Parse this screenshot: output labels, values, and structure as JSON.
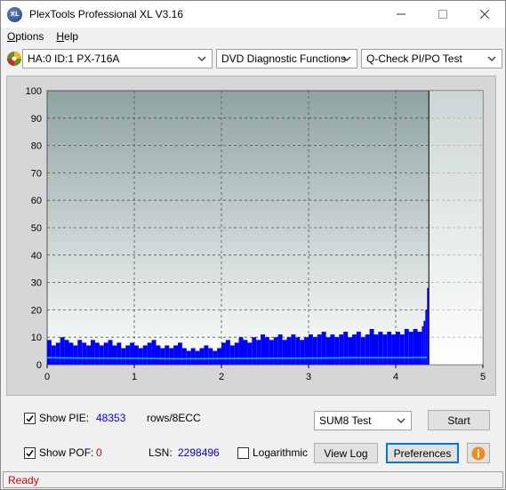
{
  "window": {
    "title": "PlexTools Professional XL V3.16",
    "icon_text": "XL"
  },
  "menu": [
    {
      "label": "Options",
      "mnemonic": "O"
    },
    {
      "label": "Help",
      "mnemonic": "H"
    }
  ],
  "toolbar": {
    "drive": "HA:0 ID:1  PX-716A",
    "function": "DVD Diagnostic Functions",
    "test": "Q-Check PI/PO Test"
  },
  "chart_data": {
    "type": "bar",
    "x_ticks": [
      "0",
      "1",
      "2",
      "3",
      "4",
      "5"
    ],
    "y_ticks": [
      "0",
      "10",
      "20",
      "30",
      "40",
      "50",
      "60",
      "70",
      "80",
      "90",
      "100"
    ],
    "xlim": [
      0,
      5
    ],
    "ylim": [
      0,
      100
    ],
    "grid": true,
    "end_marker_x": 4.38,
    "series": [
      {
        "style": "bars",
        "color": "#0000ff",
        "x": [
          0.0,
          0.05,
          0.1,
          0.15,
          0.2,
          0.25,
          0.3,
          0.35,
          0.4,
          0.45,
          0.5,
          0.55,
          0.6,
          0.65,
          0.7,
          0.75,
          0.8,
          0.85,
          0.9,
          0.95,
          1.0,
          1.05,
          1.1,
          1.15,
          1.2,
          1.25,
          1.3,
          1.35,
          1.4,
          1.45,
          1.5,
          1.55,
          1.6,
          1.65,
          1.7,
          1.75,
          1.8,
          1.85,
          1.9,
          1.95,
          2.0,
          2.05,
          2.1,
          2.15,
          2.2,
          2.25,
          2.3,
          2.35,
          2.4,
          2.45,
          2.5,
          2.55,
          2.6,
          2.65,
          2.7,
          2.75,
          2.8,
          2.85,
          2.9,
          2.95,
          3.0,
          3.05,
          3.1,
          3.15,
          3.2,
          3.25,
          3.3,
          3.35,
          3.4,
          3.45,
          3.5,
          3.55,
          3.6,
          3.65,
          3.7,
          3.75,
          3.8,
          3.85,
          3.9,
          3.95,
          4.0,
          4.05,
          4.1,
          4.15,
          4.2,
          4.25,
          4.3,
          4.32,
          4.34,
          4.36
        ],
        "y": [
          9,
          7,
          8,
          10,
          9,
          8,
          7,
          9,
          8,
          7,
          9,
          8,
          7,
          8,
          9,
          7,
          8,
          6,
          7,
          8,
          7,
          6,
          7,
          8,
          9,
          7,
          6,
          7,
          6,
          7,
          8,
          6,
          5,
          6,
          5,
          6,
          7,
          6,
          5,
          6,
          8,
          9,
          7,
          8,
          10,
          9,
          8,
          10,
          9,
          11,
          10,
          9,
          10,
          11,
          9,
          10,
          11,
          10,
          9,
          10,
          11,
          10,
          11,
          12,
          10,
          11,
          10,
          11,
          12,
          10,
          11,
          12,
          10,
          11,
          13,
          11,
          12,
          11,
          12,
          11,
          12,
          11,
          13,
          12,
          13,
          12,
          14,
          16,
          20,
          28
        ]
      },
      {
        "style": "line",
        "color": "#00c8c8",
        "x": [
          0.0,
          0.5,
          1.0,
          1.5,
          2.0,
          2.5,
          3.0,
          3.5,
          4.0,
          4.36
        ],
        "y": [
          2.5,
          2.4,
          2.3,
          2.1,
          2.2,
          2.3,
          2.4,
          2.5,
          2.5,
          2.6
        ]
      }
    ]
  },
  "panel": {
    "show_pie_label": "Show PIE:",
    "pie_value": "48353",
    "pie_unit": "rows/8ECC",
    "show_pof_label": "Show POF:",
    "pof_value": "0",
    "lsn_label": "LSN:",
    "lsn_value": "2298496",
    "logarithmic_label": "Logarithmic",
    "test_select": "SUM8 Test",
    "start_label": "Start",
    "view_log_label": "View Log",
    "preferences_label": "Preferences",
    "show_pie_checked": true,
    "show_pof_checked": true,
    "logarithmic_checked": false
  },
  "status": {
    "text": "Ready"
  },
  "colors": {
    "plot_bg_top": "#8fa3a3",
    "plot_bg_bottom": "#ffffff",
    "bars": "#0000ff",
    "baseline": "#00c8c8",
    "status_text": "#d00000",
    "value_blue": "#0000c8"
  }
}
